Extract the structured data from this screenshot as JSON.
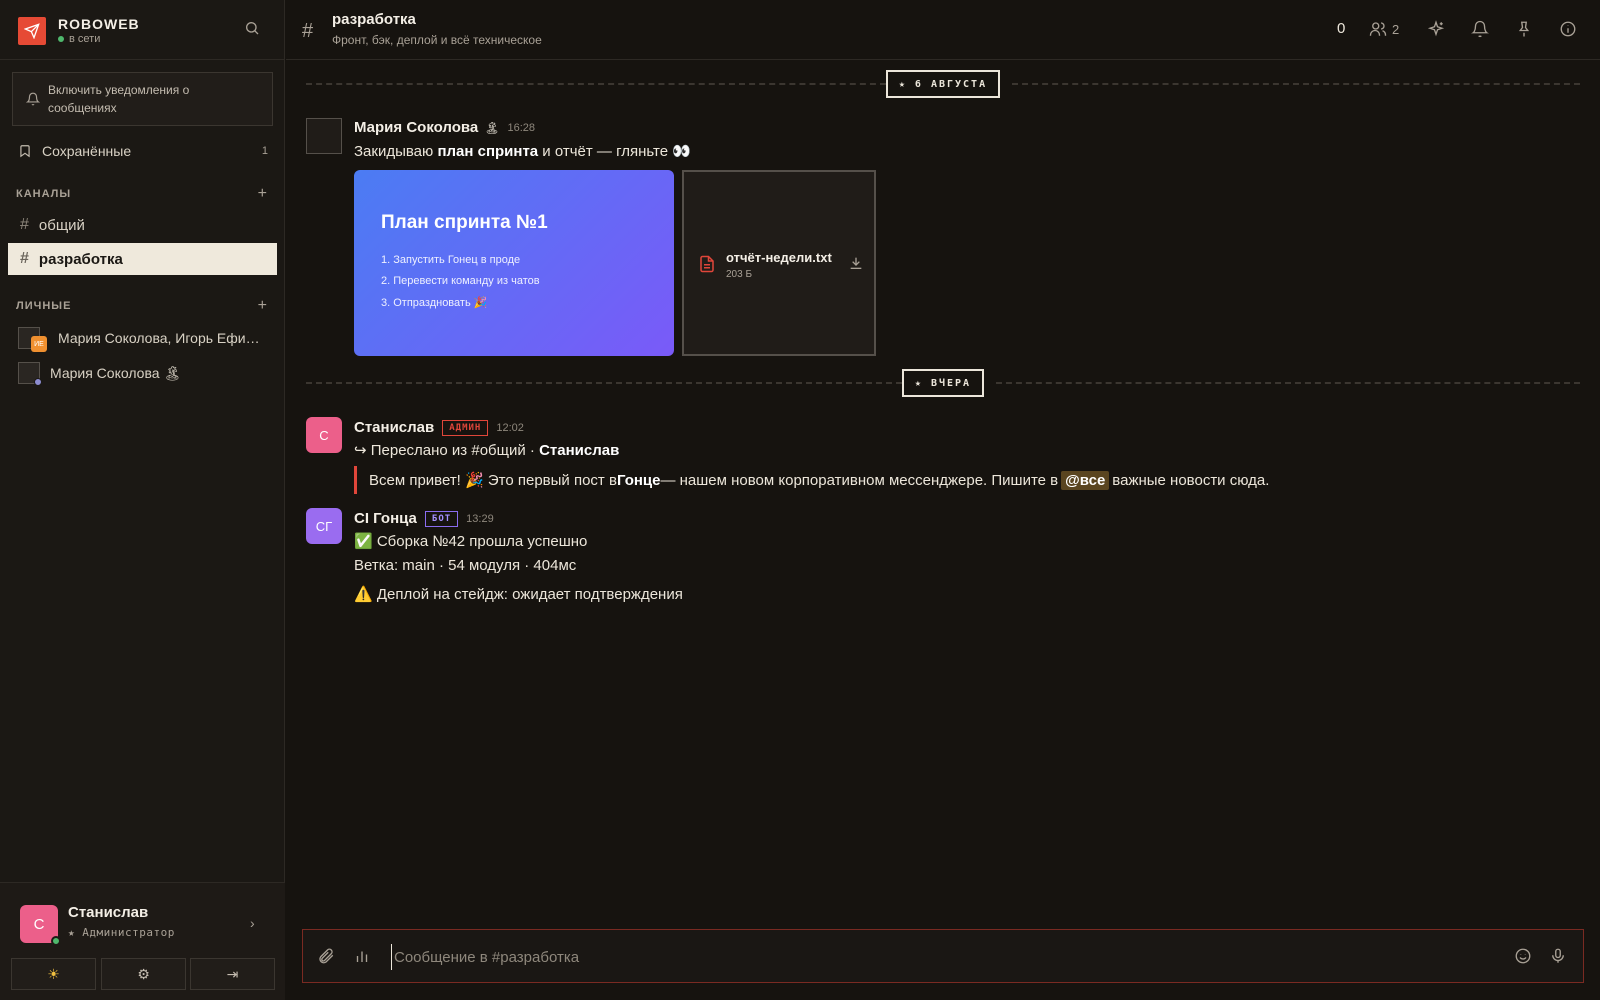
{
  "colors": {
    "accent": "#e64a35",
    "bg": "#16130f",
    "sidebar": "#1b1814",
    "online": "#4fb86d",
    "admin_badge": "#e0463a",
    "bot_badge": "#8a6cf0"
  },
  "sidebar": {
    "brand_name": "ROBOWEB",
    "brand_status": "в сети",
    "notify_text": "Включить уведомления о сообщениях",
    "saved_label": "Сохранённые",
    "saved_count": "1",
    "channels_header": "КАНАЛЫ",
    "channels": [
      {
        "label": "общий",
        "active": false
      },
      {
        "label": "разработка",
        "active": true
      }
    ],
    "dms_header": "ЛИЧНЫЕ",
    "dms": [
      {
        "label": "Мария Соколова, Игорь Ефимов",
        "badge": "ИЕ"
      },
      {
        "label": "Мария Соколова 🏝"
      }
    ],
    "user": {
      "initial": "С",
      "name": "Станислав",
      "role": "★ Администратор"
    },
    "bottom_icons": [
      "sun-icon",
      "gear-icon",
      "logout-icon"
    ],
    "bottom_glyphs": [
      "☀",
      "⚙",
      "⇥"
    ]
  },
  "header": {
    "title": "разработка",
    "subtitle": "Фронт, бэк, деплой и всё техническое",
    "count": "0",
    "members": "2"
  },
  "dividers": [
    "★ 6 АВГУСТА",
    "★ ВЧЕРА"
  ],
  "messages": [
    {
      "author": "Мария Соколова",
      "author_emoji": "🏝",
      "time": "16:28",
      "text_a": "Закидываю ",
      "text_b": "план спринта",
      "text_c": " и отчёт — гляньте 👀",
      "card": {
        "title": "План спринта №1",
        "items": [
          "1. Запустить Гонец в проде",
          "2. Перевести команду из чатов",
          "3. Отпраздновать 🎉"
        ]
      },
      "file": {
        "name": "отчёт-недели.txt",
        "size": "203 Б"
      }
    },
    {
      "avatar": "С",
      "author": "Станислав",
      "badge": "АДМИН",
      "time": "12:02",
      "forward_a": "↪ Переслано из #общий · ",
      "forward_b": "Станислав",
      "quote_a": "Всем привет! 🎉 Это первый пост в ",
      "quote_b": "Гонце",
      "quote_c": " — нашем новом корпоративном мессенджере. Пишите в",
      "quote_mention": "@все",
      "quote_d": "важные новости сюда."
    },
    {
      "avatar": "СГ",
      "author": "CI Гонца",
      "badge": "БОТ",
      "time": "13:29",
      "line1": "✅ Сборка №42 прошла успешно",
      "line2": "Ветка: main · 54 модуля · 404мс",
      "line3": "⚠️ Деплой на стейдж: ожидает подтверждения"
    }
  ],
  "composer": {
    "placeholder": "Сообщение в #разработка"
  }
}
